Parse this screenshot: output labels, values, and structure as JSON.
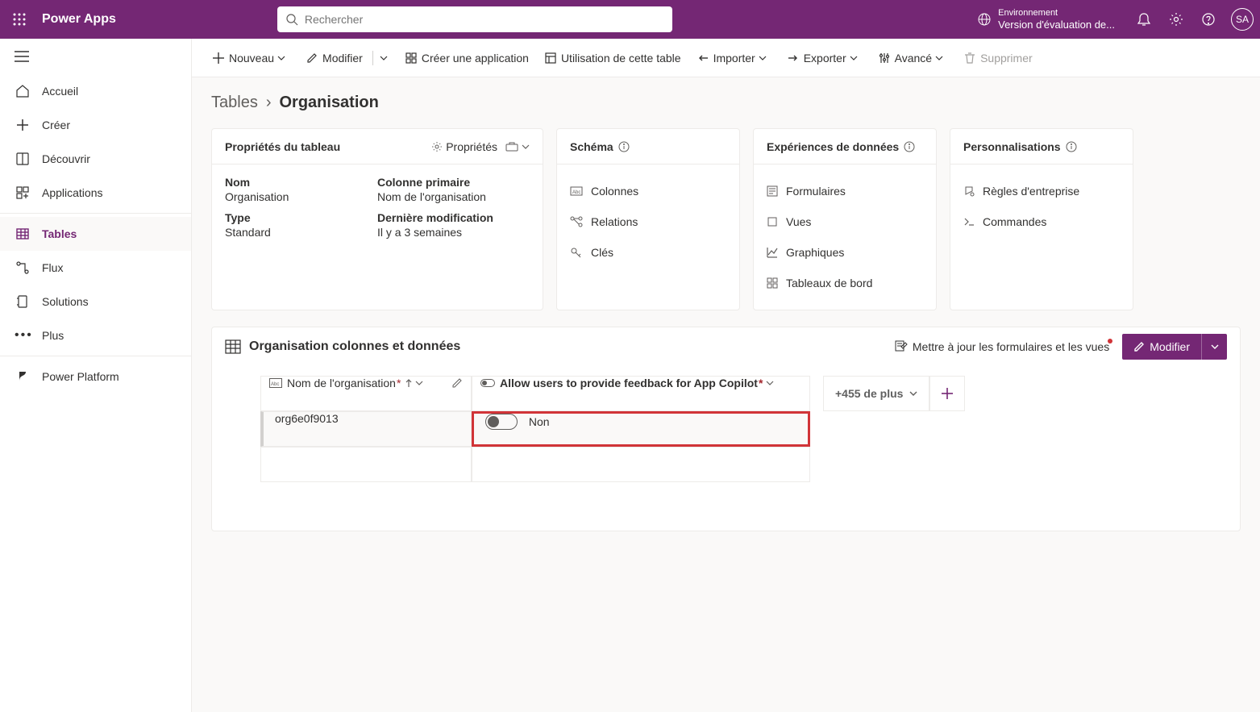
{
  "header": {
    "app_name": "Power Apps",
    "search_placeholder": "Rechercher",
    "env_label": "Environnement",
    "env_name": "Version d'évaluation de...",
    "avatar": "SA"
  },
  "sidebar": {
    "items": [
      {
        "label": "Accueil"
      },
      {
        "label": "Créer"
      },
      {
        "label": "Découvrir"
      },
      {
        "label": "Applications"
      },
      {
        "label": "Tables"
      },
      {
        "label": "Flux"
      },
      {
        "label": "Solutions"
      },
      {
        "label": "Plus"
      },
      {
        "label": "Power Platform"
      }
    ]
  },
  "toolbar": {
    "nouveau": "Nouveau",
    "modifier": "Modifier",
    "creer_app": "Créer une application",
    "utilisation": "Utilisation de cette table",
    "importer": "Importer",
    "exporter": "Exporter",
    "avance": "Avancé",
    "supprimer": "Supprimer"
  },
  "breadcrumb": {
    "parent": "Tables",
    "current": "Organisation"
  },
  "cards": {
    "properties": {
      "title": "Propriétés du tableau",
      "link": "Propriétés",
      "name_label": "Nom",
      "name_value": "Organisation",
      "type_label": "Type",
      "type_value": "Standard",
      "pk_label": "Colonne primaire",
      "pk_value": "Nom de l'organisation",
      "modified_label": "Dernière modification",
      "modified_value": "Il y a 3 semaines"
    },
    "schema": {
      "title": "Schéma",
      "links": [
        "Colonnes",
        "Relations",
        "Clés"
      ]
    },
    "dataexp": {
      "title": "Expériences de données",
      "links": [
        "Formulaires",
        "Vues",
        "Graphiques",
        "Tableaux de bord"
      ]
    },
    "custom": {
      "title": "Personnalisations",
      "links": [
        "Règles d'entreprise",
        "Commandes"
      ]
    }
  },
  "grid": {
    "title": "Organisation colonnes et données",
    "update_forms": "Mettre à jour les formulaires et les vues",
    "modifier": "Modifier",
    "col1": "Nom de l'organisation",
    "col2": "Allow users to provide feedback for App Copilot",
    "more": "+455 de plus",
    "row1_name": "org6e0f9013",
    "row1_toggle_text": "Non"
  }
}
